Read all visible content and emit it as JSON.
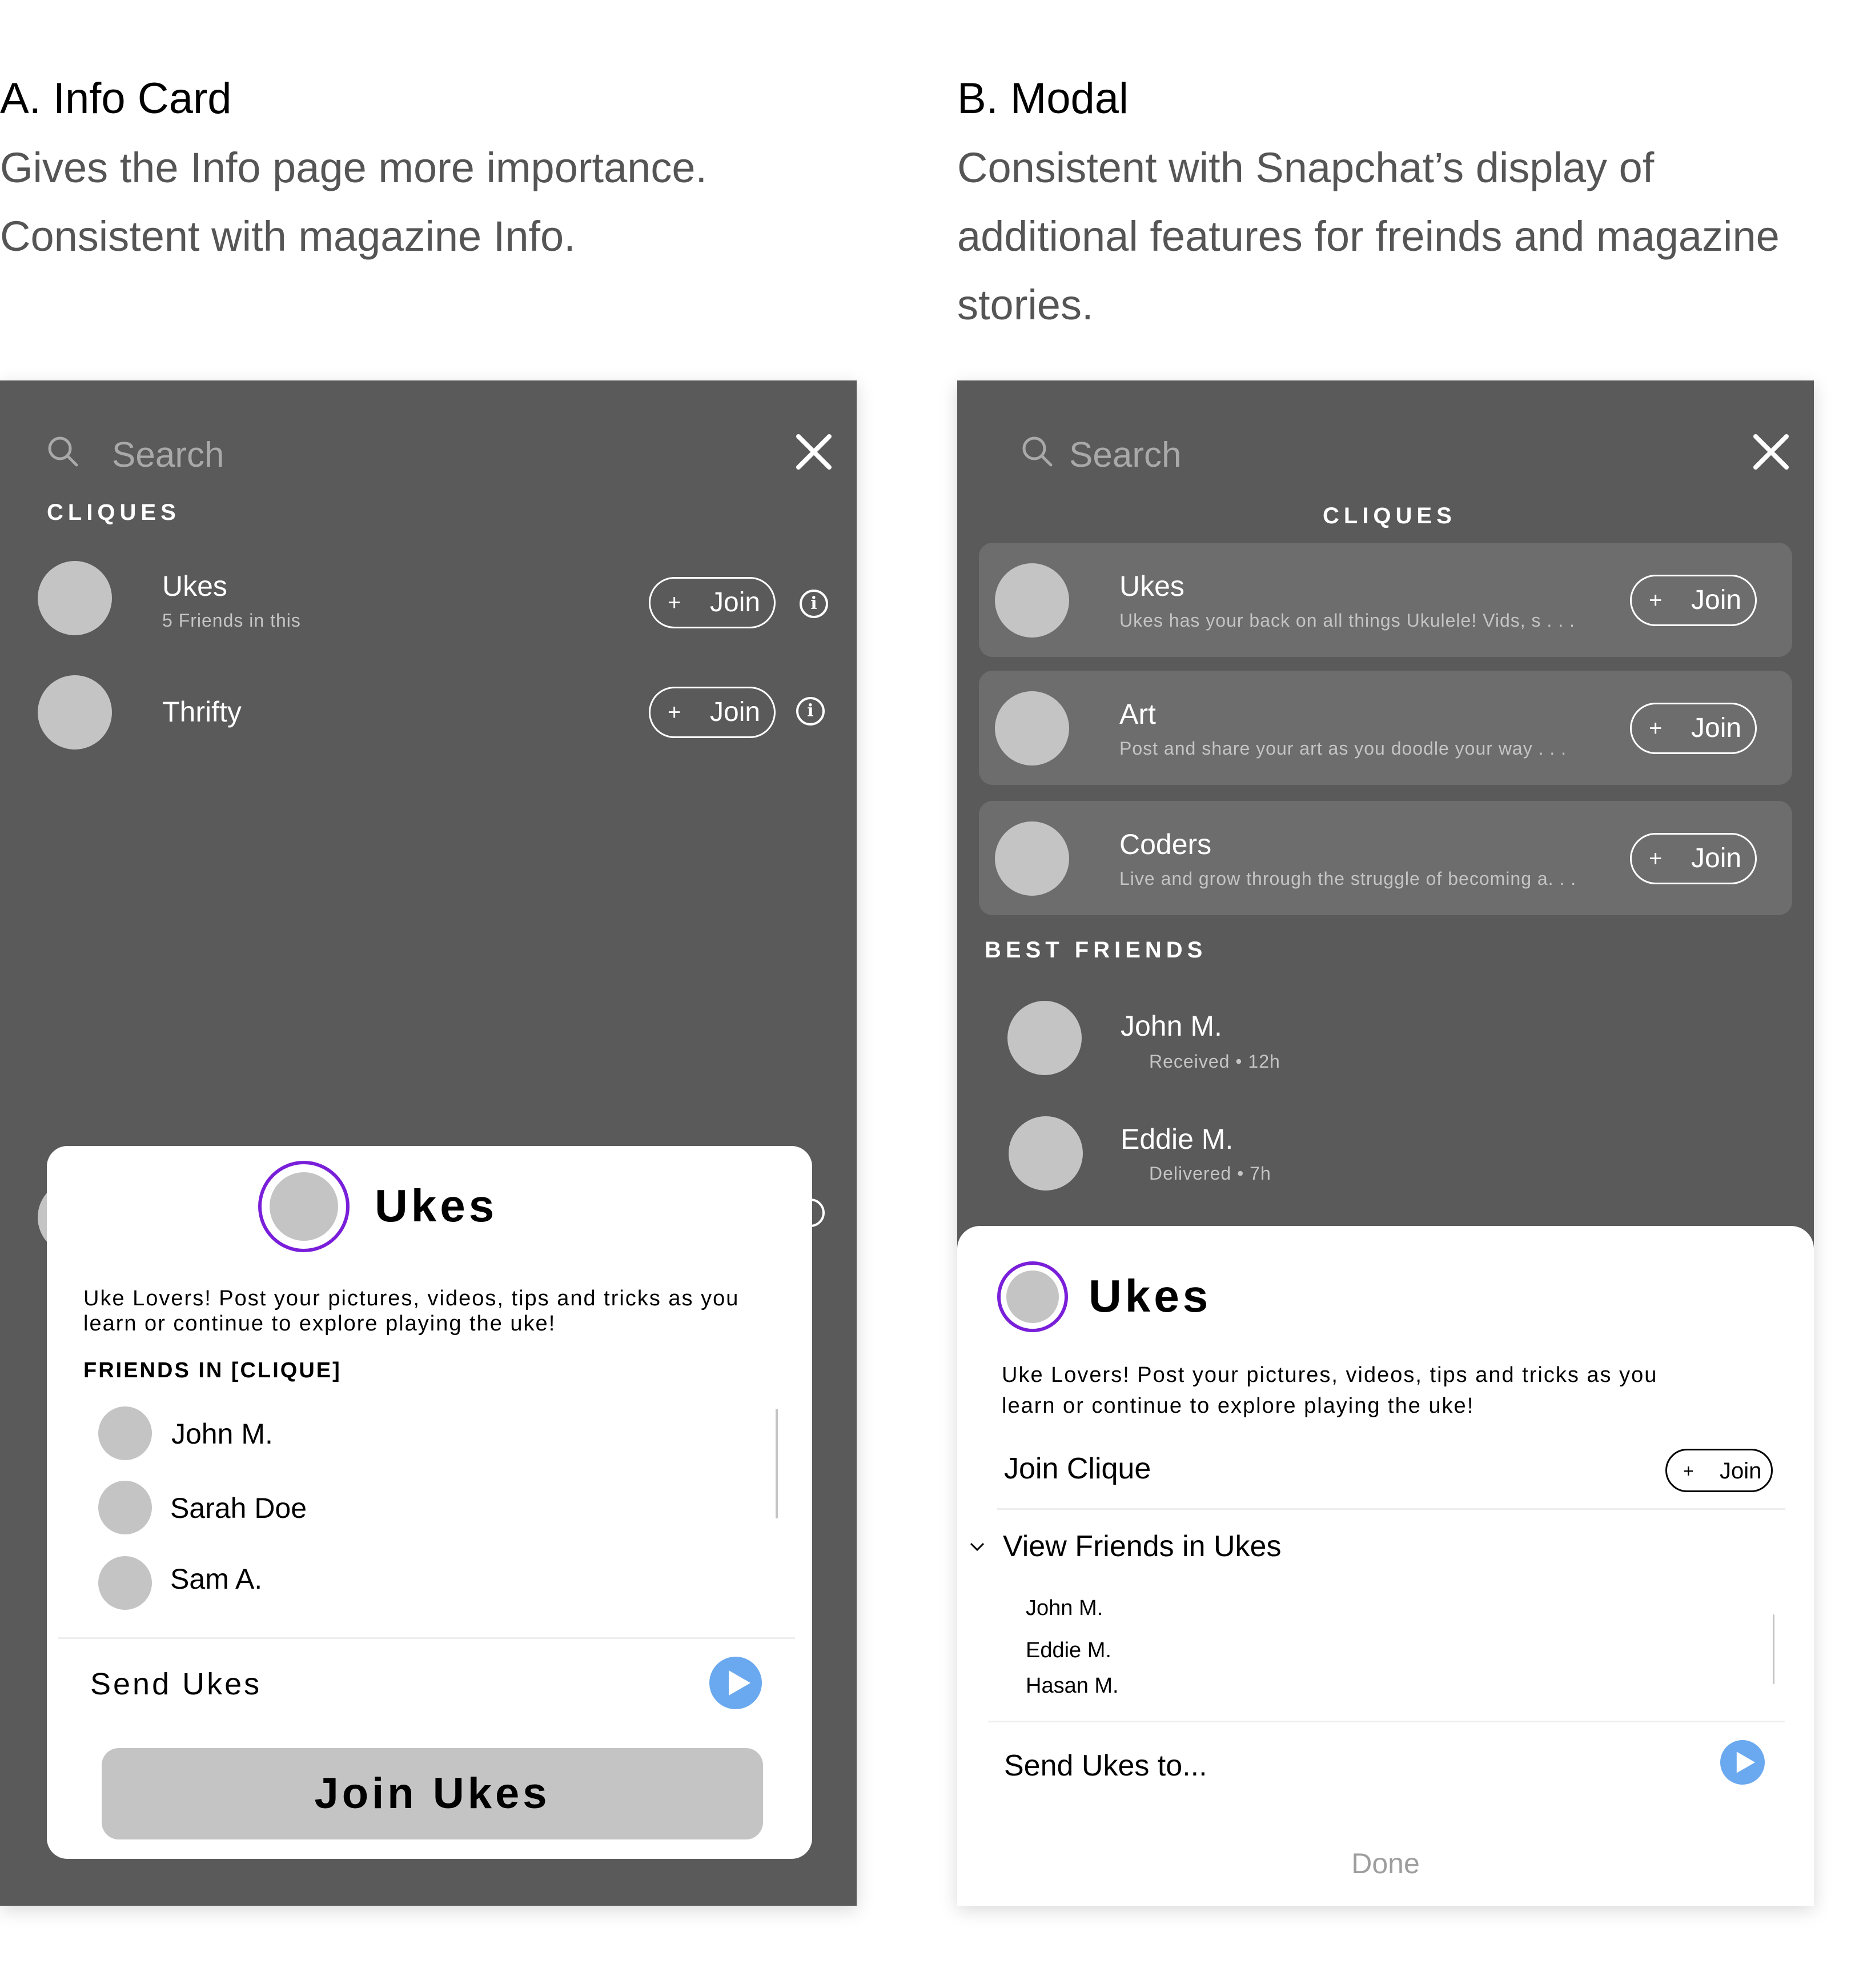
{
  "sectionA": {
    "heading": "A. Info Card",
    "desc_line1": "Gives the Info page more importance.",
    "desc_line2": "Consistent with magazine Info."
  },
  "sectionB": {
    "heading": "B. Modal",
    "desc_line1": "Consistent with Snapchat’s display of",
    "desc_line2": "additional features for freinds and magazine",
    "desc_line3": "stories."
  },
  "phoneA": {
    "search_placeholder": "Search",
    "cliques_label": "CLIQUES",
    "cliques": [
      {
        "name": "Ukes",
        "sub": "5 Friends in this",
        "join_label": "Join",
        "plus": "+",
        "info": "i"
      },
      {
        "name": "Thrifty",
        "join_label": "Join",
        "plus": "+",
        "info": "i"
      }
    ],
    "info_card": {
      "title": "Ukes",
      "desc_line1": "Uke Lovers! Post your pictures, videos, tips and tricks as you",
      "desc_line2": "learn or continue to explore playing the uke!",
      "friends_heading": "FRIENDS IN [CLIQUE]",
      "friends": [
        "John M.",
        "Sarah Doe",
        "Sam A."
      ],
      "send_label": "Send Ukes",
      "join_button": "Join Ukes"
    }
  },
  "phoneB": {
    "search_placeholder": "Search",
    "cliques_label": "CLIQUES",
    "cliques": [
      {
        "name": "Ukes",
        "desc": "Ukes has your back on all things Ukulele! Vids, s . . .",
        "join_label": "Join",
        "plus": "+"
      },
      {
        "name": "Art",
        "desc": "Post and share your art as you doodle your way . . .",
        "join_label": "Join",
        "plus": "+"
      },
      {
        "name": "Coders",
        "desc": "Live and grow through the struggle of becoming a. . .",
        "join_label": "Join",
        "plus": "+"
      }
    ],
    "best_friends_label": "BEST FRIENDS",
    "best_friends": [
      {
        "name": "John M.",
        "status": "Received • 12h"
      },
      {
        "name": "Eddie M.",
        "status": "Delivered • 7h"
      }
    ],
    "modal": {
      "title": "Ukes",
      "desc_line1": "Uke Lovers! Post your pictures, videos, tips and tricks as you",
      "desc_line2": "learn or continue to explore playing the uke!",
      "join_clique_label": "Join Clique",
      "join_label": "Join",
      "plus": "+",
      "view_friends_label": "View Friends in Ukes",
      "friends": [
        "John M.",
        "Eddie M.",
        "Hasan M."
      ],
      "send_label": "Send Ukes to...",
      "done_label": "Done"
    }
  },
  "colors": {
    "phone_bg": "#5a5a5a",
    "card_row_bg": "#6d6d6d",
    "avatar": "#c4c4c4",
    "ring": "#7a1fd9",
    "play": "#6aa9ef"
  }
}
